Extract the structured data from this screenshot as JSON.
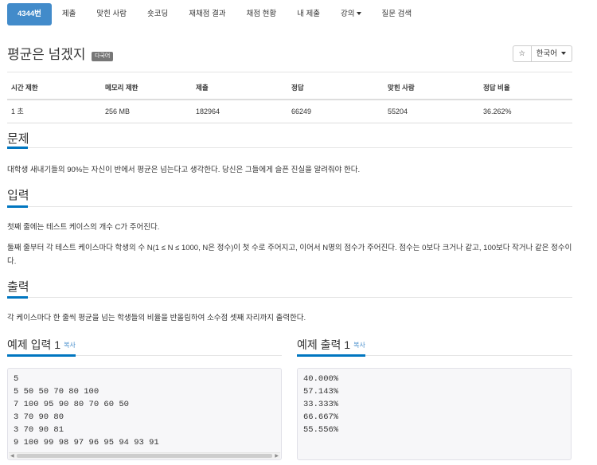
{
  "nav": {
    "tabs": [
      {
        "label": "4344번",
        "active": true
      },
      {
        "label": "제출"
      },
      {
        "label": "맞힌 사람"
      },
      {
        "label": "숏코딩"
      },
      {
        "label": "재채점 결과"
      },
      {
        "label": "채점 현황"
      },
      {
        "label": "내 제출"
      },
      {
        "label": "강의"
      },
      {
        "label": "질문 검색"
      }
    ]
  },
  "problem": {
    "title": "평균은 넘겠지",
    "badge": "다국어",
    "star_icon": "☆",
    "language": "한국어"
  },
  "info_table": {
    "headers": [
      "시간 제한",
      "메모리 제한",
      "제출",
      "정답",
      "맞힌 사람",
      "정답 비율"
    ],
    "values": [
      "1 초",
      "256 MB",
      "182964",
      "66249",
      "55204",
      "36.262%"
    ]
  },
  "sections": {
    "problem_heading": "문제",
    "problem_text": "대학생 새내기들의 90%는 자신이 반에서 평균은 넘는다고 생각한다. 당신은 그들에게 슬픈 진실을 알려줘야 한다.",
    "input_heading": "입력",
    "input_text_1": "첫째 줄에는 테스트 케이스의 개수 C가 주어진다.",
    "input_text_2": "둘째 줄부터 각 테스트 케이스마다 학생의 수 N(1 ≤ N ≤ 1000, N은 정수)이 첫 수로 주어지고, 이어서 N명의 점수가 주어진다. 점수는 0보다 크거나 같고, 100보다 작거나 같은 정수이다.",
    "output_heading": "출력",
    "output_text": "각 케이스마다 한 줄씩 평균을 넘는 학생들의 비율을 반올림하여 소수점 셋째 자리까지 출력한다."
  },
  "samples": {
    "input_heading": "예제 입력 1",
    "output_heading": "예제 출력 1",
    "copy_label": "복사",
    "input_text": "5\n5 50 50 70 80 100\n7 100 95 90 80 70 60 50\n3 70 90 80\n3 70 90 81\n9 100 99 98 97 96 95 94 93 91",
    "output_text": "40.000%\n57.143%\n33.333%\n66.667%\n55.556%"
  },
  "colors": {
    "accent": "#0076c0",
    "active_tab": "#428bca",
    "badge": "#777777"
  }
}
